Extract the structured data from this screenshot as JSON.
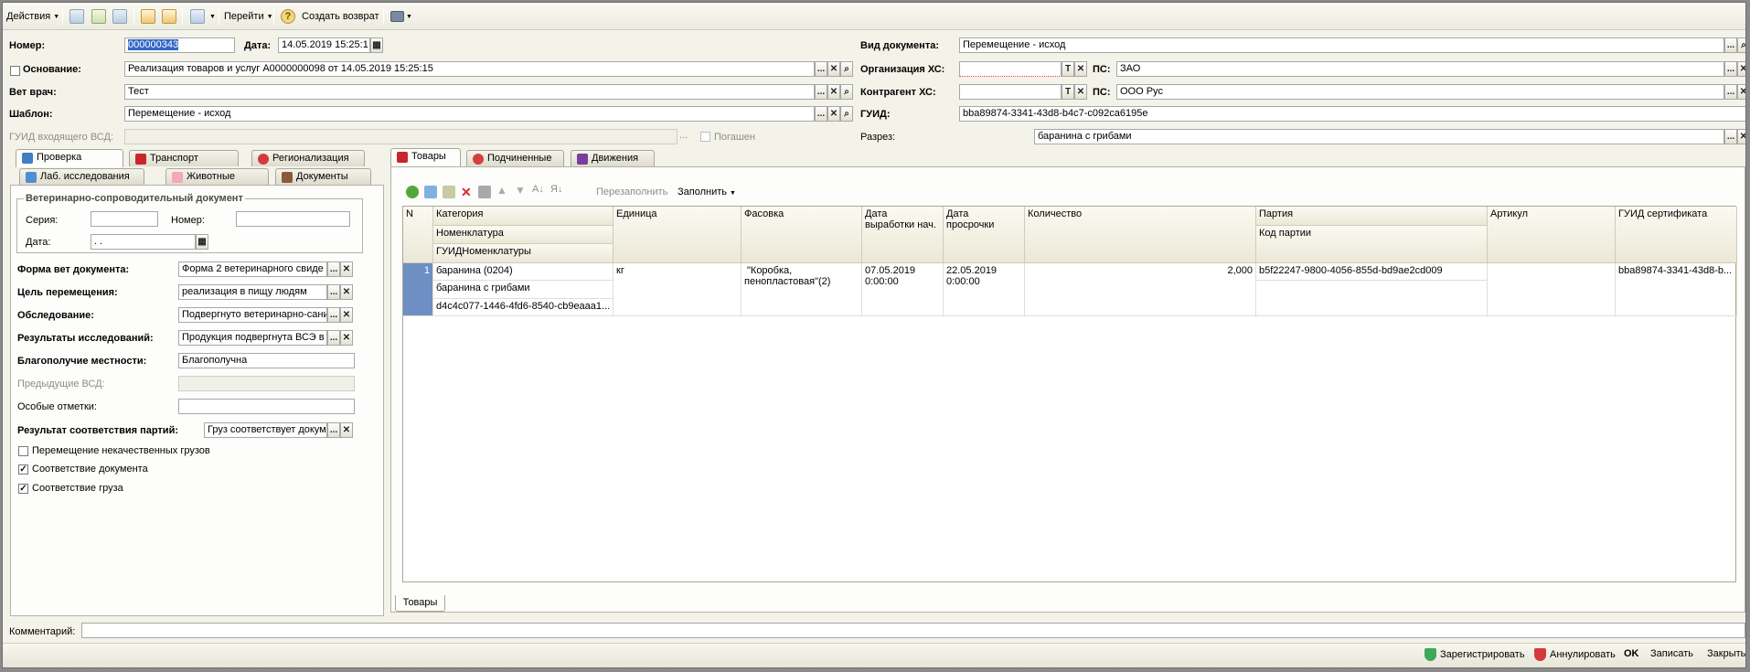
{
  "toolbar": {
    "actions": "Действия",
    "goto": "Перейти",
    "create_return": "Создать возврат",
    "help": "?"
  },
  "header": {
    "number_label": "Номер:",
    "number_value": "000000343",
    "date_label": "Дата:",
    "date_value": "14.05.2019 15:25:1",
    "basis_label": "Основание:",
    "basis_value": "Реализация товаров и услуг А0000000098 от 14.05.2019 15:25:15",
    "vet_label": "Вет врач:",
    "vet_value": "Тест",
    "template_label": "Шаблон:",
    "template_value": "Перемещение - исход",
    "incoming_guid_label": "ГУИД входящего ВСД:",
    "repaid_label": "Погашен",
    "doctype_label": "Вид документа:",
    "doctype_value": "Перемещение - исход",
    "org_label": "Организация ХС:",
    "ps_label": "ПС:",
    "org_ps_value": "ЗАО",
    "contractor_label": "Контрагент ХС:",
    "contractor_ps_value": "ООО Рус",
    "guid_label": "ГУИД:",
    "guid_value": "bba89874-3341-43d8-b4c7-c092ca6195e",
    "section_label": "Разрез:",
    "section_value": "баранина с грибами",
    "btn_dots": "...",
    "btn_x": "✕",
    "btn_search": "⌕",
    "btn_t": "T"
  },
  "left_tabs": {
    "check": "Проверка",
    "transport": "Транспорт",
    "region": "Регионализация",
    "lab": "Лаб. исследования",
    "animals": "Животные",
    "docs": "Документы"
  },
  "left": {
    "group_title": "Ветеринарно-сопроводительный документ",
    "series_label": "Серия:",
    "number_label": "Номер:",
    "date_label": "Дата:",
    "date_value": " .  .",
    "form_label": "Форма вет документа:",
    "form_value": "Форма 2 ветеринарного свиде",
    "purpose_label": "Цель перемещения:",
    "purpose_value": "реализация в пищу людям",
    "inspection_label": "Обследование:",
    "inspection_value": "Подвергнуто ветеринарно-сани",
    "research_label": "Результаты исследований:",
    "research_value": "Продукция подвергнута ВСЭ в г",
    "wellbeing_label": "Благополучие местности:",
    "wellbeing_value": "Благополучна",
    "prev_label": "Предыдущие ВСД:",
    "marks_label": "Особые отметки:",
    "conformity_label": "Результат соответствия партий:",
    "conformity_value": "Груз соответствует докум",
    "cb1_label": "Перемещение некачественных грузов",
    "cb1_checked": false,
    "cb2_label": "Соответствие документа",
    "cb2_checked": true,
    "cb3_label": "Соответствие груза",
    "cb3_checked": true
  },
  "right_tabs": {
    "goods": "Товары",
    "subordinate": "Подчиненные",
    "movements": "Движения"
  },
  "grid_toolbar": {
    "refill": "Перезаполнить",
    "fill": "Заполнить"
  },
  "grid": {
    "headers": {
      "n": "N",
      "category": "Категория",
      "nomenclature": "Номенклатура",
      "guid_nom": "ГУИДНоменклатуры",
      "unit": "Единица",
      "packing": "Фасовка",
      "prod_date_1": "Дата",
      "prod_date_2": "выработки нач.",
      "exp_date_1": "Дата",
      "exp_date_2": "просрочки",
      "quantity": "Количество",
      "batch": "Партия",
      "batch_code": "Код партии",
      "article": "Артикул",
      "cert_guid": "ГУИД сертификата"
    },
    "rows": [
      {
        "n": "1",
        "category": "баранина (0204)",
        "nomenclature": "баранина с грибами",
        "guid_nom": "d4c4c077-1446-4fd6-8540-cb9eaaa1...",
        "unit": "кг",
        "packing_1": "\"Коробка,",
        "packing_2": "пенопластовая\"(2)",
        "prod_date_1": "07.05.2019",
        "prod_date_2": "0:00:00",
        "exp_date_1": "22.05.2019",
        "exp_date_2": "0:00:00",
        "quantity": "2,000",
        "batch": "b5f22247-9800-4056-855d-bd9ae2cd009",
        "article": "",
        "cert_guid": "bba89874-3341-43d8-b..."
      }
    ]
  },
  "bottom_tab": "Товары",
  "comment_label": "Комментарий:",
  "status": {
    "register": "Зарегистрировать",
    "annul": "Аннулировать",
    "ok": "OK",
    "save": "Записать",
    "close": "Закрыть"
  }
}
